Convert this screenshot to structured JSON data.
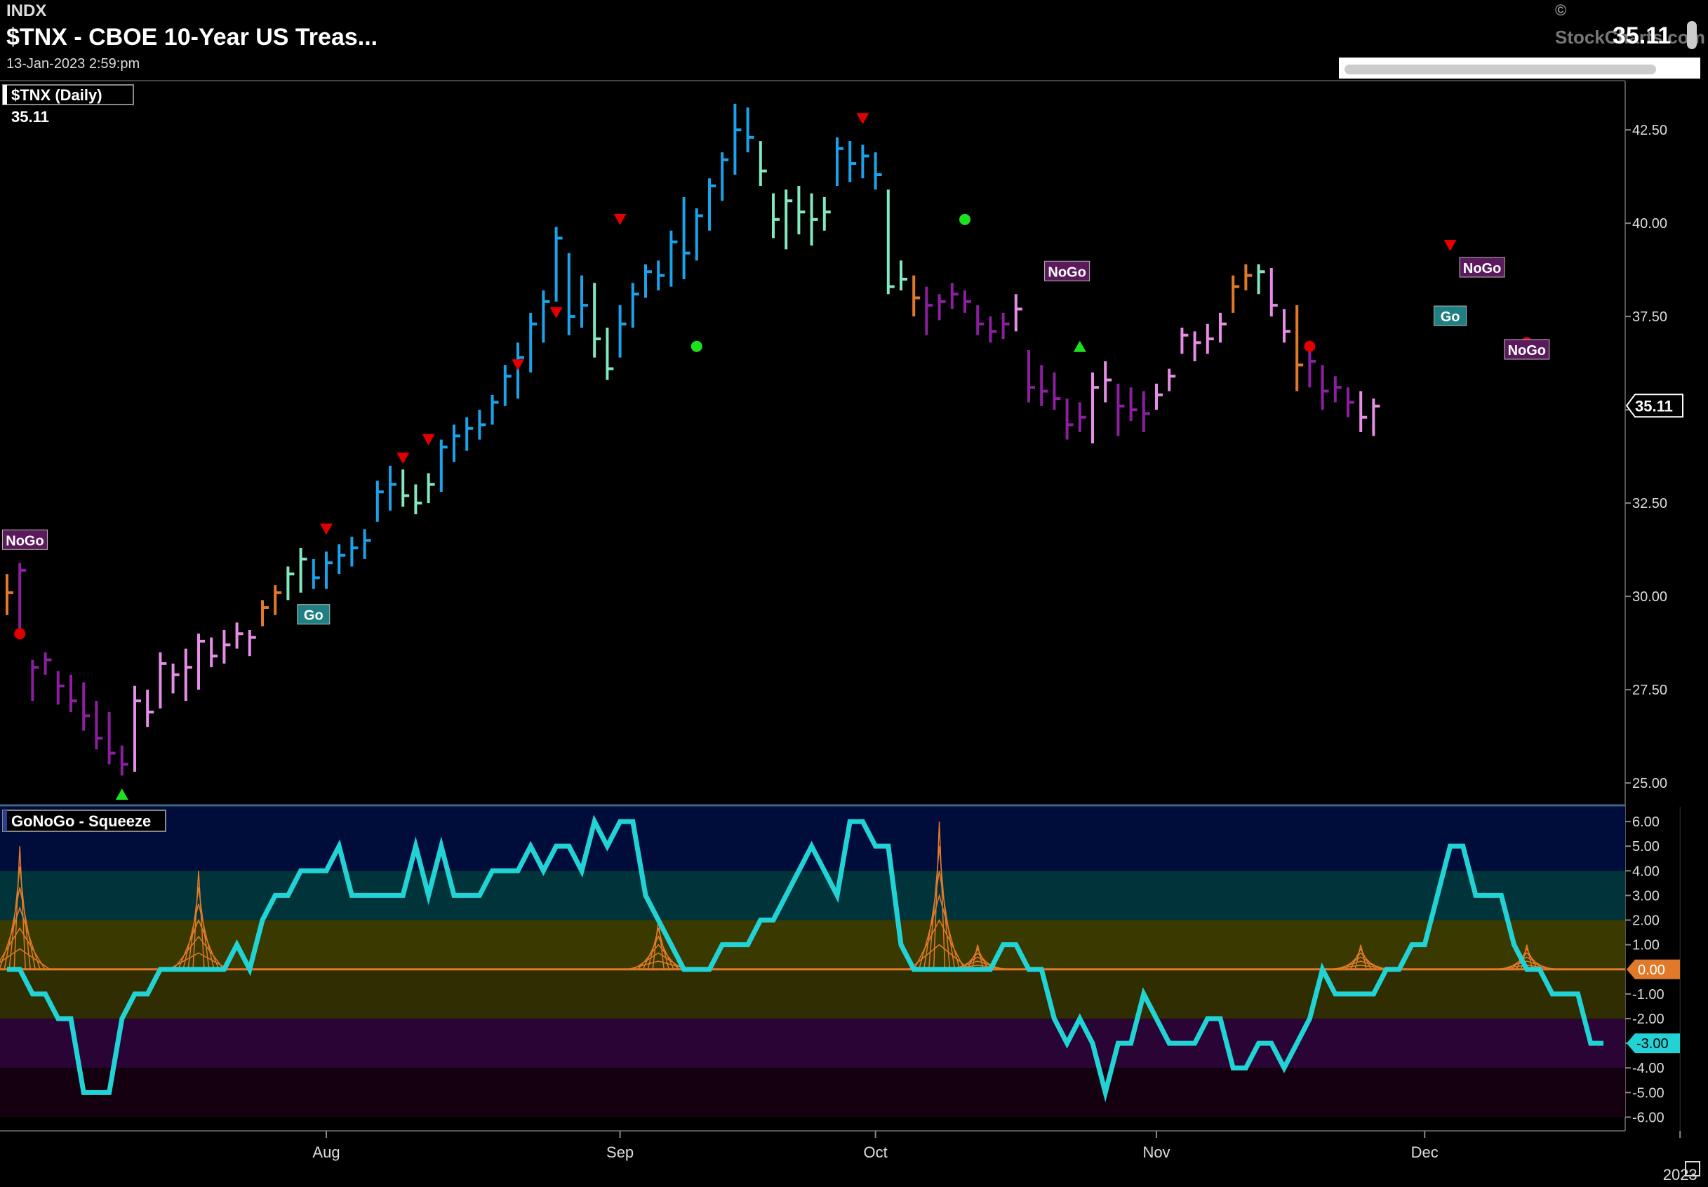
{
  "header": {
    "exchange": "INDX",
    "title": "$TNX - CBOE 10-Year US Treas...",
    "datetime": "13-Jan-2023 2:59:pm",
    "last_price": "35.11",
    "copyright": "©",
    "watermark": "StockCharts.com"
  },
  "colors": {
    "background": "#000000",
    "go_strong": "#1aa3ea",
    "go_weak": "#82e8c0",
    "nogo_strong": "#8b1fa0",
    "nogo_weak": "#e68ee6",
    "neutral": "#e07a2a",
    "oscillator": "#22d3d6",
    "zero_line": "#e07a2a",
    "down_triangle": "#e00000",
    "up_triangle": "#1ee01e",
    "dot_red": "#e00000",
    "dot_green": "#1ee01e",
    "go_label_bg": "#1f7f82",
    "nogo_label_bg": "#5a1a5c"
  },
  "chart_data": [
    {
      "type": "ohlc",
      "legend": "$TNX (Daily)",
      "legend_value": "35.11",
      "price_tag": "35.11",
      "ylim": [
        24.4,
        43.8
      ],
      "y_ticks": [
        "42.50",
        "40.00",
        "37.50",
        "35.00",
        "32.50",
        "30.00",
        "27.50",
        "25.00"
      ],
      "x_ticks": [
        {
          "label": "Aug",
          "index": 25
        },
        {
          "label": "Sep",
          "index": 48
        },
        {
          "label": "Oct",
          "index": 68
        },
        {
          "label": "Nov",
          "index": 90
        },
        {
          "label": "Dec",
          "index": 111
        },
        {
          "label": "2023",
          "index": 131
        }
      ],
      "bars": [
        {
          "h": 30.6,
          "l": 29.5,
          "c": 30.1,
          "color": "neutral"
        },
        {
          "h": 30.9,
          "l": 29.1,
          "c": 30.7,
          "color": "nogo_strong"
        },
        {
          "h": 28.3,
          "l": 27.2,
          "c": 28.1,
          "color": "nogo_strong"
        },
        {
          "h": 28.5,
          "l": 27.9,
          "c": 28.3,
          "color": "nogo_strong"
        },
        {
          "h": 28.0,
          "l": 27.1,
          "c": 27.6,
          "color": "nogo_strong"
        },
        {
          "h": 27.9,
          "l": 26.9,
          "c": 27.2,
          "color": "nogo_strong"
        },
        {
          "h": 27.7,
          "l": 26.4,
          "c": 26.8,
          "color": "nogo_strong"
        },
        {
          "h": 27.2,
          "l": 25.9,
          "c": 26.2,
          "color": "nogo_strong"
        },
        {
          "h": 26.9,
          "l": 25.5,
          "c": 25.8,
          "color": "nogo_strong"
        },
        {
          "h": 26.0,
          "l": 25.2,
          "c": 25.5,
          "color": "nogo_strong"
        },
        {
          "h": 27.6,
          "l": 25.3,
          "c": 27.2,
          "color": "nogo_weak"
        },
        {
          "h": 27.5,
          "l": 26.5,
          "c": 26.9,
          "color": "nogo_weak"
        },
        {
          "h": 28.5,
          "l": 27.0,
          "c": 28.2,
          "color": "nogo_weak"
        },
        {
          "h": 28.2,
          "l": 27.4,
          "c": 27.9,
          "color": "nogo_weak"
        },
        {
          "h": 28.6,
          "l": 27.2,
          "c": 28.1,
          "color": "nogo_weak"
        },
        {
          "h": 29.0,
          "l": 27.5,
          "c": 28.8,
          "color": "nogo_weak"
        },
        {
          "h": 28.9,
          "l": 28.1,
          "c": 28.4,
          "color": "nogo_weak"
        },
        {
          "h": 29.1,
          "l": 28.2,
          "c": 28.7,
          "color": "nogo_weak"
        },
        {
          "h": 29.3,
          "l": 28.6,
          "c": 29.0,
          "color": "nogo_weak"
        },
        {
          "h": 29.1,
          "l": 28.4,
          "c": 28.9,
          "color": "nogo_weak"
        },
        {
          "h": 29.9,
          "l": 29.2,
          "c": 29.7,
          "color": "neutral"
        },
        {
          "h": 30.3,
          "l": 29.5,
          "c": 30.1,
          "color": "neutral"
        },
        {
          "h": 30.8,
          "l": 29.9,
          "c": 30.6,
          "color": "go_weak"
        },
        {
          "h": 31.3,
          "l": 30.1,
          "c": 31.0,
          "color": "go_weak"
        },
        {
          "h": 31.0,
          "l": 30.2,
          "c": 30.5,
          "color": "go_strong"
        },
        {
          "h": 31.2,
          "l": 30.2,
          "c": 30.9,
          "color": "go_strong"
        },
        {
          "h": 31.4,
          "l": 30.6,
          "c": 31.1,
          "color": "go_strong"
        },
        {
          "h": 31.6,
          "l": 30.8,
          "c": 31.3,
          "color": "go_strong"
        },
        {
          "h": 31.8,
          "l": 31.0,
          "c": 31.5,
          "color": "go_strong"
        },
        {
          "h": 33.1,
          "l": 32.0,
          "c": 32.8,
          "color": "go_strong"
        },
        {
          "h": 33.5,
          "l": 32.3,
          "c": 33.0,
          "color": "go_strong"
        },
        {
          "h": 33.4,
          "l": 32.4,
          "c": 32.7,
          "color": "go_weak"
        },
        {
          "h": 33.0,
          "l": 32.2,
          "c": 32.5,
          "color": "go_weak"
        },
        {
          "h": 33.3,
          "l": 32.5,
          "c": 33.0,
          "color": "go_weak"
        },
        {
          "h": 34.2,
          "l": 32.8,
          "c": 34.0,
          "color": "go_strong"
        },
        {
          "h": 34.6,
          "l": 33.6,
          "c": 34.3,
          "color": "go_strong"
        },
        {
          "h": 34.8,
          "l": 33.9,
          "c": 34.5,
          "color": "go_strong"
        },
        {
          "h": 35.0,
          "l": 34.2,
          "c": 34.6,
          "color": "go_strong"
        },
        {
          "h": 35.4,
          "l": 34.6,
          "c": 35.2,
          "color": "go_strong"
        },
        {
          "h": 36.2,
          "l": 35.1,
          "c": 35.9,
          "color": "go_strong"
        },
        {
          "h": 36.8,
          "l": 35.3,
          "c": 36.4,
          "color": "go_strong"
        },
        {
          "h": 37.6,
          "l": 36.0,
          "c": 37.3,
          "color": "go_strong"
        },
        {
          "h": 38.2,
          "l": 36.8,
          "c": 37.9,
          "color": "go_strong"
        },
        {
          "h": 39.9,
          "l": 37.9,
          "c": 39.6,
          "color": "go_strong"
        },
        {
          "h": 39.2,
          "l": 37.0,
          "c": 37.5,
          "color": "go_strong"
        },
        {
          "h": 38.6,
          "l": 37.2,
          "c": 37.8,
          "color": "go_strong"
        },
        {
          "h": 38.4,
          "l": 36.4,
          "c": 36.9,
          "color": "go_weak"
        },
        {
          "h": 37.2,
          "l": 35.8,
          "c": 36.1,
          "color": "go_weak"
        },
        {
          "h": 37.8,
          "l": 36.4,
          "c": 37.3,
          "color": "go_strong"
        },
        {
          "h": 38.4,
          "l": 37.2,
          "c": 38.1,
          "color": "go_strong"
        },
        {
          "h": 38.9,
          "l": 38.0,
          "c": 38.7,
          "color": "go_strong"
        },
        {
          "h": 39.0,
          "l": 38.2,
          "c": 38.6,
          "color": "go_strong"
        },
        {
          "h": 39.8,
          "l": 38.3,
          "c": 39.5,
          "color": "go_strong"
        },
        {
          "h": 40.7,
          "l": 38.5,
          "c": 39.2,
          "color": "go_strong"
        },
        {
          "h": 40.4,
          "l": 39.0,
          "c": 40.2,
          "color": "go_strong"
        },
        {
          "h": 41.2,
          "l": 39.8,
          "c": 41.0,
          "color": "go_strong"
        },
        {
          "h": 41.9,
          "l": 40.6,
          "c": 41.7,
          "color": "go_strong"
        },
        {
          "h": 43.2,
          "l": 41.3,
          "c": 42.5,
          "color": "go_strong"
        },
        {
          "h": 43.1,
          "l": 41.9,
          "c": 42.3,
          "color": "go_strong"
        },
        {
          "h": 42.2,
          "l": 41.0,
          "c": 41.4,
          "color": "go_weak"
        },
        {
          "h": 40.8,
          "l": 39.6,
          "c": 40.1,
          "color": "go_weak"
        },
        {
          "h": 40.9,
          "l": 39.3,
          "c": 40.6,
          "color": "go_weak"
        },
        {
          "h": 41.0,
          "l": 39.7,
          "c": 40.3,
          "color": "go_weak"
        },
        {
          "h": 40.8,
          "l": 39.4,
          "c": 40.1,
          "color": "go_weak"
        },
        {
          "h": 40.7,
          "l": 39.8,
          "c": 40.3,
          "color": "go_weak"
        },
        {
          "h": 42.3,
          "l": 41.0,
          "c": 42.0,
          "color": "go_strong"
        },
        {
          "h": 42.2,
          "l": 41.1,
          "c": 41.6,
          "color": "go_strong"
        },
        {
          "h": 42.1,
          "l": 41.2,
          "c": 41.8,
          "color": "go_strong"
        },
        {
          "h": 41.9,
          "l": 40.9,
          "c": 41.3,
          "color": "go_strong"
        },
        {
          "h": 40.9,
          "l": 38.1,
          "c": 38.3,
          "color": "go_weak"
        },
        {
          "h": 39.0,
          "l": 38.2,
          "c": 38.5,
          "color": "go_weak"
        },
        {
          "h": 38.6,
          "l": 37.5,
          "c": 38.0,
          "color": "neutral"
        },
        {
          "h": 38.3,
          "l": 37.0,
          "c": 37.8,
          "color": "nogo_strong"
        },
        {
          "h": 38.1,
          "l": 37.4,
          "c": 37.9,
          "color": "nogo_strong"
        },
        {
          "h": 38.4,
          "l": 37.7,
          "c": 38.1,
          "color": "nogo_strong"
        },
        {
          "h": 38.2,
          "l": 37.6,
          "c": 37.9,
          "color": "nogo_strong"
        },
        {
          "h": 37.8,
          "l": 37.0,
          "c": 37.3,
          "color": "nogo_strong"
        },
        {
          "h": 37.5,
          "l": 36.8,
          "c": 37.1,
          "color": "nogo_strong"
        },
        {
          "h": 37.6,
          "l": 36.9,
          "c": 37.3,
          "color": "nogo_strong"
        },
        {
          "h": 38.1,
          "l": 37.1,
          "c": 37.7,
          "color": "nogo_weak"
        },
        {
          "h": 36.6,
          "l": 35.2,
          "c": 35.6,
          "color": "nogo_strong"
        },
        {
          "h": 36.2,
          "l": 35.1,
          "c": 35.5,
          "color": "nogo_strong"
        },
        {
          "h": 36.0,
          "l": 35.0,
          "c": 35.3,
          "color": "nogo_strong"
        },
        {
          "h": 35.3,
          "l": 34.2,
          "c": 34.6,
          "color": "nogo_strong"
        },
        {
          "h": 35.2,
          "l": 34.4,
          "c": 34.8,
          "color": "nogo_strong"
        },
        {
          "h": 36.0,
          "l": 34.1,
          "c": 35.6,
          "color": "nogo_weak"
        },
        {
          "h": 36.3,
          "l": 35.2,
          "c": 35.8,
          "color": "nogo_weak"
        },
        {
          "h": 35.7,
          "l": 34.3,
          "c": 35.1,
          "color": "nogo_strong"
        },
        {
          "h": 35.6,
          "l": 34.7,
          "c": 35.0,
          "color": "nogo_strong"
        },
        {
          "h": 35.5,
          "l": 34.4,
          "c": 34.9,
          "color": "nogo_strong"
        },
        {
          "h": 35.7,
          "l": 35.0,
          "c": 35.4,
          "color": "nogo_weak"
        },
        {
          "h": 36.1,
          "l": 35.5,
          "c": 35.9,
          "color": "nogo_weak"
        },
        {
          "h": 37.2,
          "l": 36.5,
          "c": 37.0,
          "color": "nogo_weak"
        },
        {
          "h": 37.1,
          "l": 36.3,
          "c": 36.8,
          "color": "nogo_weak"
        },
        {
          "h": 37.3,
          "l": 36.5,
          "c": 36.9,
          "color": "nogo_weak"
        },
        {
          "h": 37.6,
          "l": 36.8,
          "c": 37.3,
          "color": "nogo_weak"
        },
        {
          "h": 38.6,
          "l": 37.6,
          "c": 38.3,
          "color": "neutral"
        },
        {
          "h": 38.9,
          "l": 38.2,
          "c": 38.6,
          "color": "neutral"
        },
        {
          "h": 38.9,
          "l": 38.1,
          "c": 38.7,
          "color": "go_weak"
        },
        {
          "h": 38.8,
          "l": 37.5,
          "c": 37.8,
          "color": "nogo_weak"
        },
        {
          "h": 37.7,
          "l": 36.8,
          "c": 37.1,
          "color": "nogo_weak"
        },
        {
          "h": 37.8,
          "l": 35.5,
          "c": 36.2,
          "color": "neutral"
        },
        {
          "h": 36.8,
          "l": 35.6,
          "c": 36.3,
          "color": "nogo_strong"
        },
        {
          "h": 36.2,
          "l": 35.0,
          "c": 35.5,
          "color": "nogo_strong"
        },
        {
          "h": 35.9,
          "l": 35.2,
          "c": 35.6,
          "color": "nogo_strong"
        },
        {
          "h": 35.6,
          "l": 34.8,
          "c": 35.2,
          "color": "nogo_strong"
        },
        {
          "h": 35.5,
          "l": 34.4,
          "c": 34.8,
          "color": "nogo_weak"
        },
        {
          "h": 35.3,
          "l": 34.3,
          "c": 35.1,
          "color": "nogo_weak"
        }
      ],
      "signals": [
        {
          "index": 1,
          "price": 29.0,
          "kind": "dot_red"
        },
        {
          "index": 9,
          "price": 24.7,
          "kind": "up_triangle"
        },
        {
          "index": 25,
          "price": 31.8,
          "kind": "down_triangle"
        },
        {
          "index": 31,
          "price": 33.7,
          "kind": "down_triangle"
        },
        {
          "index": 33,
          "price": 34.2,
          "kind": "down_triangle"
        },
        {
          "index": 40,
          "price": 36.2,
          "kind": "down_triangle"
        },
        {
          "index": 43,
          "price": 37.6,
          "kind": "down_triangle"
        },
        {
          "index": 48,
          "price": 40.1,
          "kind": "down_triangle"
        },
        {
          "index": 54,
          "price": 36.7,
          "kind": "dot_green"
        },
        {
          "index": 67,
          "price": 42.8,
          "kind": "down_triangle"
        },
        {
          "index": 75,
          "price": 40.1,
          "kind": "dot_green"
        },
        {
          "index": 84,
          "price": 36.7,
          "kind": "up_triangle"
        },
        {
          "index": 102,
          "price": 36.7,
          "kind": "dot_red"
        },
        {
          "index": 113,
          "price": 39.4,
          "kind": "down_triangle"
        },
        {
          "index": 119,
          "price": 36.8,
          "kind": "dot_red"
        }
      ],
      "tags": [
        {
          "text": "NoGo",
          "index": 1.4,
          "price": 31.5,
          "kind": "nogo"
        },
        {
          "text": "Go",
          "index": 24,
          "price": 29.5,
          "kind": "go"
        },
        {
          "text": "NoGo",
          "index": 83,
          "price": 38.7,
          "kind": "nogo"
        },
        {
          "text": "Go",
          "index": 113,
          "price": 37.5,
          "kind": "go"
        },
        {
          "text": "NoGo",
          "index": 115.5,
          "price": 38.8,
          "kind": "nogo"
        },
        {
          "text": "NoGo",
          "index": 119,
          "price": 36.6,
          "kind": "nogo"
        }
      ]
    },
    {
      "type": "line",
      "legend": "GoNoGo - Squeeze",
      "ylim": [
        -6.5,
        6.6
      ],
      "y_ticks": [
        "6.00",
        "5.00",
        "4.00",
        "3.00",
        "2.00",
        "1.00",
        "-1.00",
        "-2.00",
        "-3.00",
        "-4.00",
        "-5.00",
        "-6.00"
      ],
      "zero_tag": "0.00",
      "last_tag": "-3.00",
      "values": [
        0,
        0,
        -1,
        -1,
        -2,
        -2,
        -5,
        -5,
        -5,
        -2,
        -1,
        -1,
        0,
        0,
        0,
        0,
        0,
        0,
        1,
        0,
        2,
        3,
        3,
        4,
        4,
        4,
        5,
        3,
        3,
        3,
        3,
        3,
        5,
        3,
        5,
        3,
        3,
        3,
        4,
        4,
        4,
        5,
        4,
        5,
        5,
        4,
        6,
        5,
        6,
        6,
        3,
        2,
        1,
        0,
        0,
        0,
        1,
        1,
        1,
        2,
        2,
        3,
        4,
        5,
        4,
        3,
        6,
        6,
        5,
        5,
        1,
        0,
        0,
        0,
        0,
        0,
        0,
        0,
        1,
        1,
        0,
        0,
        -2,
        -3,
        -2,
        -3,
        -5,
        -3,
        -3,
        -1,
        -2,
        -3,
        -3,
        -3,
        -2,
        -2,
        -4,
        -4,
        -3,
        -3,
        -4,
        -3,
        -2,
        0,
        -1,
        -1,
        -1,
        -1,
        0,
        0,
        1,
        1,
        3,
        5,
        5,
        3,
        3,
        3,
        1,
        0,
        0,
        -1,
        -1,
        -1,
        -3,
        -3
      ],
      "squeeze_spikes": [
        {
          "index": 1,
          "height": 5
        },
        {
          "index": 15,
          "height": 4
        },
        {
          "index": 51,
          "height": 2
        },
        {
          "index": 73,
          "height": 6
        },
        {
          "index": 76,
          "height": 1
        },
        {
          "index": 106,
          "height": 1
        },
        {
          "index": 119,
          "height": 1
        }
      ]
    }
  ]
}
